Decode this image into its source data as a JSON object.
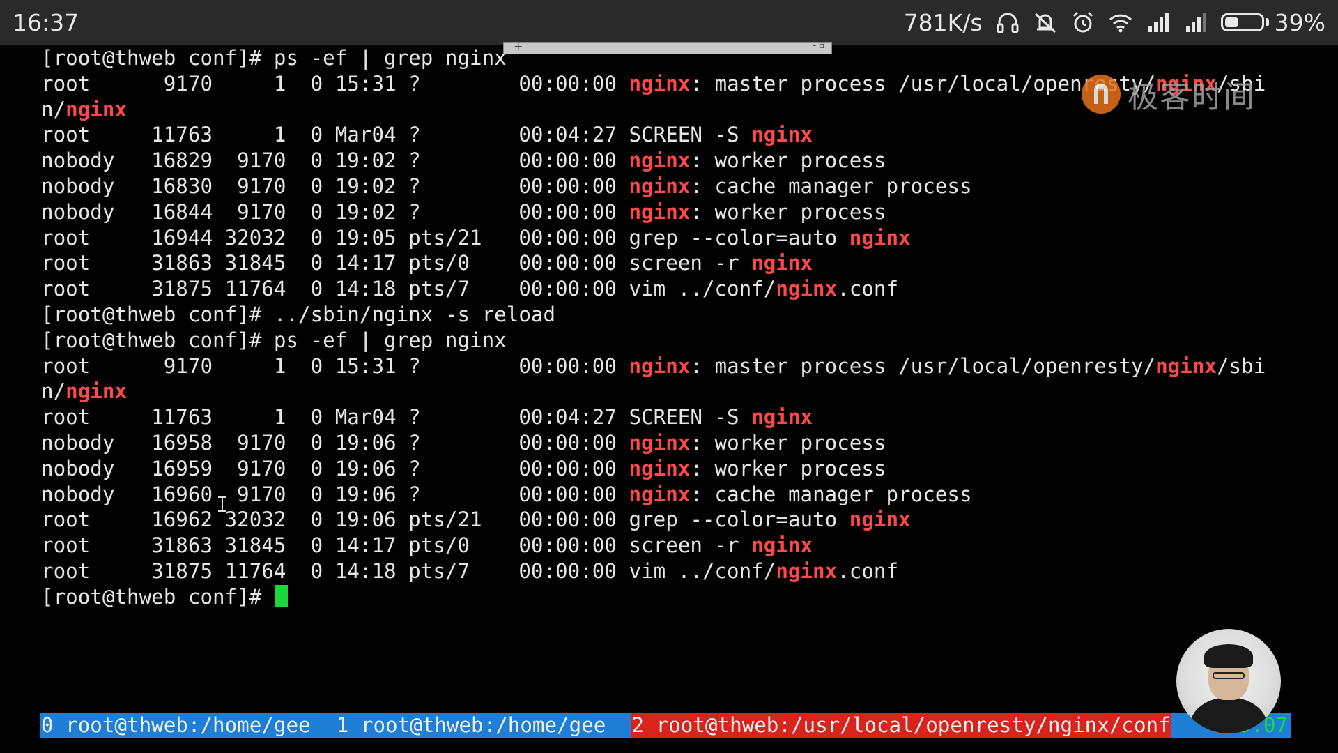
{
  "statusbar": {
    "time": "16:37",
    "speed": "781K/s",
    "battery_percent": "39%",
    "battery_level": 0.39,
    "icons": [
      "headphones-icon",
      "mute-icon",
      "alarm-icon",
      "wifi-icon",
      "signal-icon",
      "signal-icon-2",
      "battery-icon"
    ]
  },
  "watermark": {
    "text": "极客时间"
  },
  "terminal": {
    "lines": [
      [
        {
          "t": "[root@thweb conf]# ps -ef | grep nginx"
        }
      ],
      [
        {
          "t": "root      9170     1  0 15:31 ?        00:00:00 "
        },
        {
          "t": "nginx",
          "hl": true
        },
        {
          "t": ": master process /usr/local/openresty/"
        },
        {
          "t": "nginx",
          "hl": true
        },
        {
          "t": "/sbi"
        }
      ],
      [
        {
          "t": "n/"
        },
        {
          "t": "nginx",
          "hl": true
        }
      ],
      [
        {
          "t": "root     11763     1  0 Mar04 ?        00:04:27 SCREEN -S "
        },
        {
          "t": "nginx",
          "hl": true
        }
      ],
      [
        {
          "t": "nobody   16829  9170  0 19:02 ?        00:00:00 "
        },
        {
          "t": "nginx",
          "hl": true
        },
        {
          "t": ": worker process"
        }
      ],
      [
        {
          "t": "nobody   16830  9170  0 19:02 ?        00:00:00 "
        },
        {
          "t": "nginx",
          "hl": true
        },
        {
          "t": ": cache manager process"
        }
      ],
      [
        {
          "t": "nobody   16844  9170  0 19:02 ?        00:00:00 "
        },
        {
          "t": "nginx",
          "hl": true
        },
        {
          "t": ": worker process"
        }
      ],
      [
        {
          "t": "root     16944 32032  0 19:05 pts/21   00:00:00 grep --color=auto "
        },
        {
          "t": "nginx",
          "hl": true
        }
      ],
      [
        {
          "t": "root     31863 31845  0 14:17 pts/0    00:00:00 screen -r "
        },
        {
          "t": "nginx",
          "hl": true
        }
      ],
      [
        {
          "t": "root     31875 11764  0 14:18 pts/7    00:00:00 vim ../conf/"
        },
        {
          "t": "nginx",
          "hl": true
        },
        {
          "t": ".conf"
        }
      ],
      [
        {
          "t": "[root@thweb conf]# ../sbin/nginx -s reload"
        }
      ],
      [
        {
          "t": "[root@thweb conf]# ps -ef | grep nginx"
        }
      ],
      [
        {
          "t": "root      9170     1  0 15:31 ?        00:00:00 "
        },
        {
          "t": "nginx",
          "hl": true
        },
        {
          "t": ": master process /usr/local/openresty/"
        },
        {
          "t": "nginx",
          "hl": true
        },
        {
          "t": "/sbi"
        }
      ],
      [
        {
          "t": "n/"
        },
        {
          "t": "nginx",
          "hl": true
        }
      ],
      [
        {
          "t": "root     11763     1  0 Mar04 ?        00:04:27 SCREEN -S "
        },
        {
          "t": "nginx",
          "hl": true
        }
      ],
      [
        {
          "t": "nobody   16958  9170  0 19:06 ?        00:00:00 "
        },
        {
          "t": "nginx",
          "hl": true
        },
        {
          "t": ": worker process"
        }
      ],
      [
        {
          "t": "nobody   16959  9170  0 19:06 ?        00:00:00 "
        },
        {
          "t": "nginx",
          "hl": true
        },
        {
          "t": ": worker process"
        }
      ],
      [
        {
          "t": "nobody   16960  9170  0 19:06 ?        00:00:00 "
        },
        {
          "t": "nginx",
          "hl": true
        },
        {
          "t": ": cache manager process"
        }
      ],
      [
        {
          "t": "root     16962 32032  0 19:06 pts/21   00:00:00 grep --color=auto "
        },
        {
          "t": "nginx",
          "hl": true
        }
      ],
      [
        {
          "t": "root     31863 31845  0 14:17 pts/0    00:00:00 screen -r "
        },
        {
          "t": "nginx",
          "hl": true
        }
      ],
      [
        {
          "t": "root     31875 11764  0 14:18 pts/7    00:00:00 vim ../conf/"
        },
        {
          "t": "nginx",
          "hl": true
        },
        {
          "t": ".conf"
        }
      ],
      [
        {
          "t": "[root@thweb conf]# "
        }
      ]
    ],
    "highlight_color": "#ff4848",
    "cursor_color": "#19d93d"
  },
  "screen_bar": {
    "windows": [
      {
        "label": "0 root@thweb:/home/gee  ",
        "active": false
      },
      {
        "label": "1 root@thweb:/home/gee  ",
        "active": false
      },
      {
        "label": "2 root@thweb:/usr/local/openresty/nginx/conf",
        "active": true
      }
    ],
    "clock": "19:07",
    "inactive_color": "#1f7fd6",
    "active_color": "#d8241c"
  }
}
